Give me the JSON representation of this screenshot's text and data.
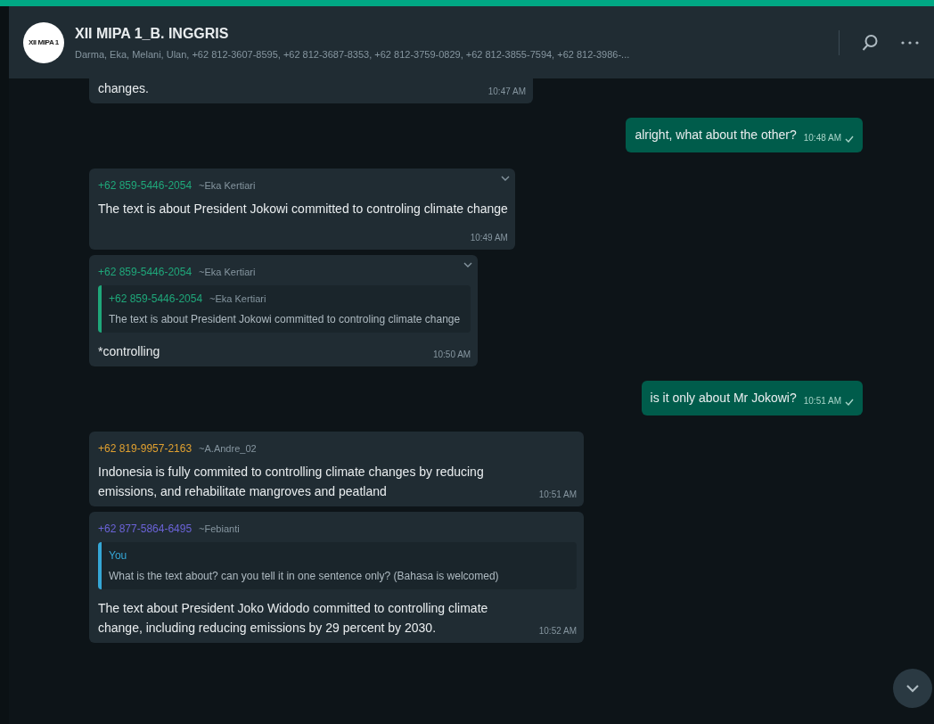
{
  "header": {
    "avatar_text": "XII MIPA 1",
    "title": "XII MIPA 1_B. INGGRIS",
    "subtitle": "Darma, Eka, Melani, Ulan, +62 812-3607-8595, +62 812-3687-8353, +62 812-3759-0829, +62 812-3855-7594, +62 812-3986-..."
  },
  "messages": [
    {
      "kind": "incoming",
      "text": "changes.",
      "time": "10:47 AM",
      "hovered": false
    },
    {
      "kind": "outgoing",
      "text": "alright, what about the other?",
      "time": "10:48 AM"
    },
    {
      "kind": "incoming",
      "sender": "+62 859-5446-2054",
      "sender_name": "~Eka Kertiari",
      "color": "#1fa77a",
      "text": "The text is about President Jokowi committed to controling climate change",
      "time": "10:49 AM",
      "hovered": true,
      "tall": true
    },
    {
      "kind": "incoming",
      "sender": "+62 859-5446-2054",
      "sender_name": "~Eka Kertiari",
      "color": "#1fa77a",
      "quote": {
        "author": "+62 859-5446-2054",
        "author_name": "~Eka Kertiari",
        "color": "#1fa77a",
        "text": "The text is about President Jokowi committed to controling climate change"
      },
      "text": "*controlling",
      "time": "10:50 AM",
      "hovered": true
    },
    {
      "kind": "outgoing",
      "text": "is it only about Mr Jokowi?",
      "time": "10:51 AM"
    },
    {
      "kind": "incoming",
      "sender": "+62 819-9957-2163",
      "sender_name": "~A.Andre_02",
      "color": "#e0a030",
      "text": "Indonesia is fully commited to controlling climate changes by reducing emissions, and rehabilitate mangroves and peatland",
      "time": "10:51 AM",
      "hovered": false
    },
    {
      "kind": "incoming",
      "sender": "+62 877-5864-6495",
      "sender_name": "~Febianti",
      "color": "#6b63d8",
      "quote": {
        "author": "You",
        "color": "#35a7d6",
        "text": "What is the text about? can you tell it in one sentence only? (Bahasa is welcomed)"
      },
      "text": "The text about President Joko Widodo committed to controlling climate change, including reducing emissions by 29 percent by 2030.",
      "time": "10:52 AM",
      "hovered": false
    }
  ]
}
